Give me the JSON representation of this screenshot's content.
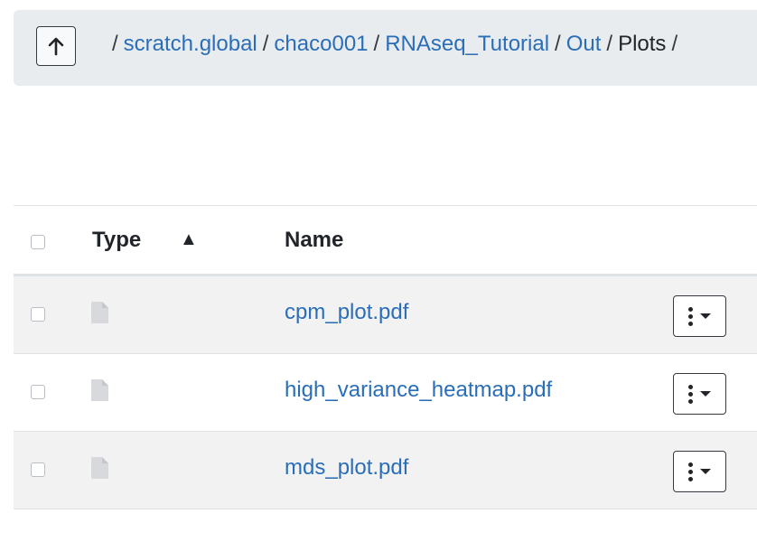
{
  "breadcrumb": {
    "separator": "/",
    "links": [
      "scratch.global",
      "chaco001",
      "RNAseq_Tutorial",
      "Out"
    ],
    "current": "Plots"
  },
  "table": {
    "columns": {
      "type": "Type",
      "name": "Name"
    },
    "sort": {
      "column": "Type",
      "direction": "ascending"
    },
    "rows": [
      {
        "name": "cpm_plot.pdf",
        "icon": "file-icon"
      },
      {
        "name": "high_variance_heatmap.pdf",
        "icon": "file-icon"
      },
      {
        "name": "mds_plot.pdf",
        "icon": "file-icon"
      }
    ]
  },
  "colors": {
    "link": "#2a6eb8",
    "pathbar_bg": "#e9ecef",
    "row_stripe": "#f2f2f2"
  }
}
